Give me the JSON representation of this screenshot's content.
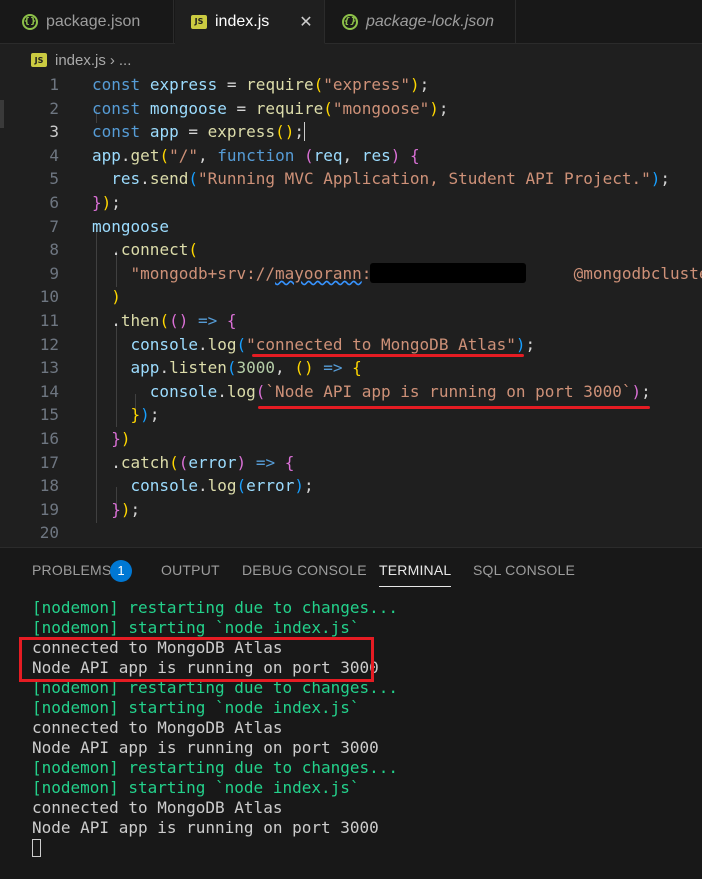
{
  "tabs": [
    {
      "label": "package.json",
      "icon": "json-icon",
      "active": false
    },
    {
      "label": "index.js",
      "icon": "js-icon",
      "active": true
    },
    {
      "label": "package-lock.json",
      "icon": "json-icon",
      "active": false
    }
  ],
  "breadcrumb": {
    "file": "index.js",
    "sep": "›",
    "rest": "..."
  },
  "editor": {
    "current_line": 3,
    "line_numbers": [
      "1",
      "2",
      "3",
      "4",
      "5",
      "6",
      "7",
      "8",
      "9",
      "10",
      "11",
      "12",
      "13",
      "14",
      "15",
      "16",
      "17",
      "18",
      "19",
      "20"
    ]
  },
  "panel": {
    "tabs": [
      "PROBLEMS",
      "OUTPUT",
      "DEBUG CONSOLE",
      "TERMINAL",
      "SQL CONSOLE"
    ],
    "active_tab": "TERMINAL",
    "problems_count": "1"
  },
  "terminal": {
    "lines": [
      {
        "text": "[nodemon] restarting due to changes...",
        "green": true
      },
      {
        "text": "[nodemon] starting `node index.js`",
        "green": true
      },
      {
        "text": "connected to MongoDB Atlas",
        "green": false
      },
      {
        "text": "Node API app is running on port 3000",
        "green": false
      },
      {
        "text": "[nodemon] restarting due to changes...",
        "green": true
      },
      {
        "text": "[nodemon] starting `node index.js`",
        "green": true
      },
      {
        "text": "connected to MongoDB Atlas",
        "green": false
      },
      {
        "text": "Node API app is running on port 3000",
        "green": false
      },
      {
        "text": "[nodemon] restarting due to changes...",
        "green": true
      },
      {
        "text": "[nodemon] starting `node index.js`",
        "green": true
      },
      {
        "text": "connected to MongoDB Atlas",
        "green": false
      },
      {
        "text": "Node API app is running on port 3000",
        "green": false
      }
    ]
  },
  "colors": {
    "accent": "#0078d4",
    "annotation": "#e51c23",
    "terminal_green": "#23d18b"
  }
}
